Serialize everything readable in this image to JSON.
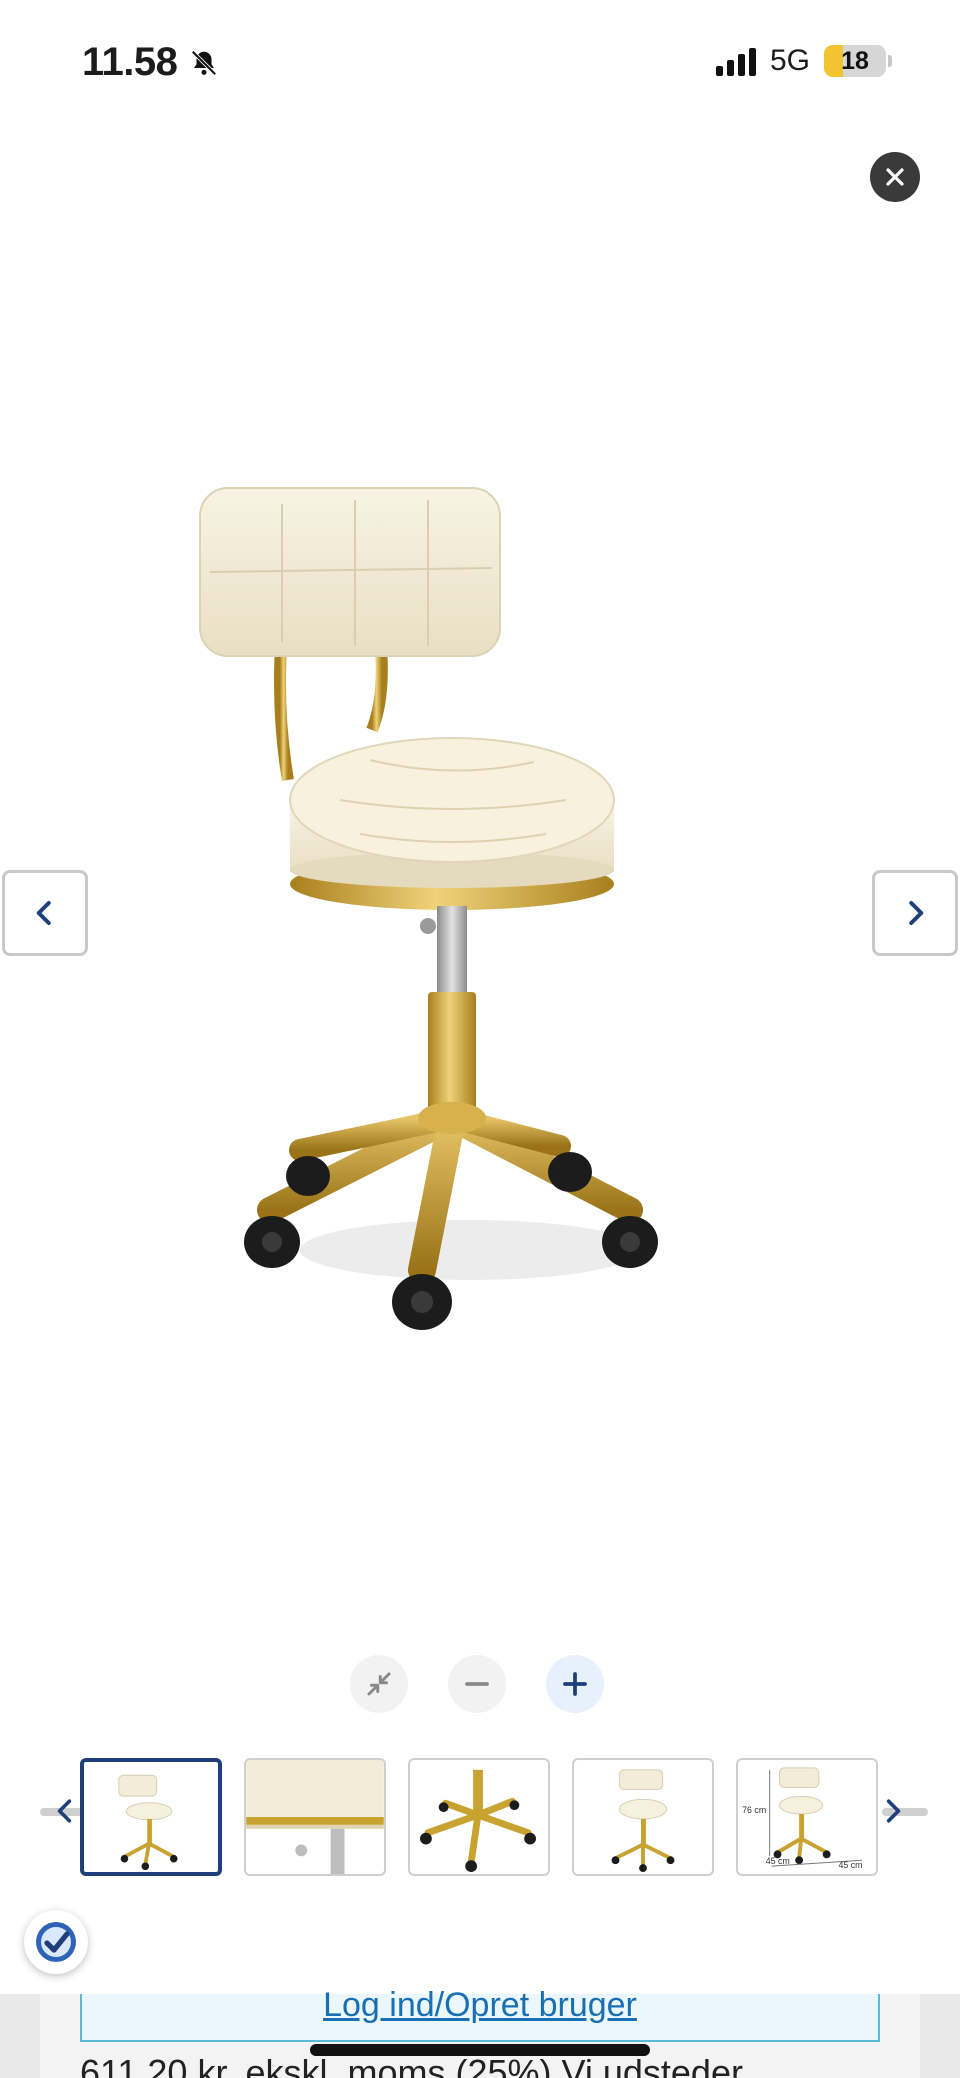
{
  "status_bar": {
    "time": "11.58",
    "network": "5G",
    "battery_level": "18",
    "icons": [
      "bell-slash-icon",
      "signal-icon",
      "battery-icon"
    ]
  },
  "lightbox": {
    "close_icon": "close-icon",
    "prev_icon": "chevron-left-icon",
    "next_icon": "chevron-right-icon",
    "zoom": {
      "reset_icon": "collapse-arrows-icon",
      "zoom_out_icon": "minus-icon",
      "zoom_in_icon": "plus-icon"
    },
    "thumbnails": [
      {
        "name": "thumb-front-view",
        "selected": true
      },
      {
        "name": "thumb-seat-closeup",
        "selected": false
      },
      {
        "name": "thumb-base-closeup",
        "selected": false
      },
      {
        "name": "thumb-side-view",
        "selected": false
      },
      {
        "name": "thumb-dimensions",
        "selected": false,
        "labels": [
          "76 cm",
          "45 cm",
          "45 cm"
        ]
      }
    ]
  },
  "page": {
    "login_link": "Log ind/Opret bruger",
    "price_line": "611,20 kr. ekskl. moms (25%) Vi udsteder"
  },
  "colors": {
    "accent": "#1f3f7a",
    "link": "#1a6fb3",
    "gold": "#c9a332",
    "cream": "#f3ecd8"
  }
}
